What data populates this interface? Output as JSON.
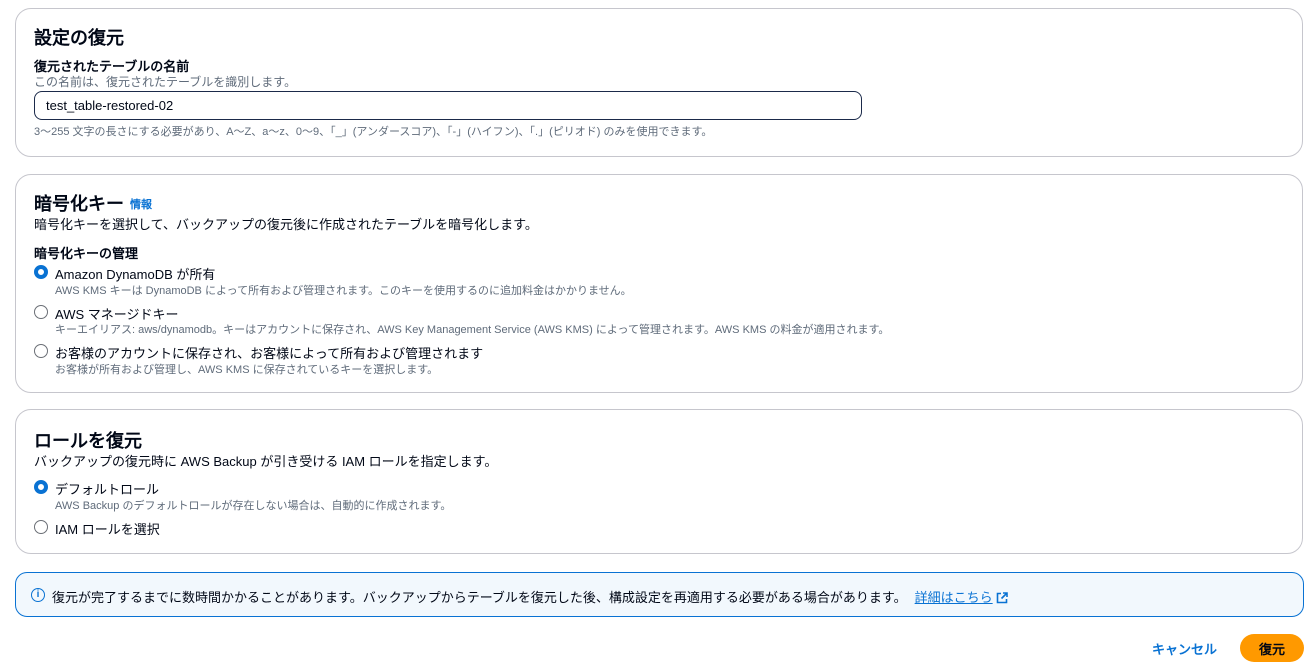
{
  "settings": {
    "title": "設定の復元",
    "name_label": "復元されたテーブルの名前",
    "name_description": "この名前は、復元されたテーブルを識別します。",
    "name_value": "test_table-restored-02",
    "name_constraint": "3～255 文字の長さにする必要があり、A～Z、a～z、0～9、「_」(アンダースコア)、「-」(ハイフン)、「.」(ピリオド) のみを使用できます。"
  },
  "encryption": {
    "title": "暗号化キー",
    "info_link": "情報",
    "description": "暗号化キーを選択して、バックアップの復元後に作成されたテーブルを暗号化します。",
    "management_label": "暗号化キーの管理",
    "options": [
      {
        "label": "Amazon DynamoDB が所有",
        "description": "AWS KMS キーは DynamoDB によって所有および管理されます。このキーを使用するのに追加料金はかかりません。",
        "checked": true
      },
      {
        "label": "AWS マネージドキー",
        "description": "キーエイリアス: aws/dynamodb。キーはアカウントに保存され、AWS Key Management Service (AWS KMS) によって管理されます。AWS KMS の料金が適用されます。",
        "checked": false
      },
      {
        "label": "お客様のアカウントに保存され、お客様によって所有および管理されます",
        "description": "お客様が所有および管理し、AWS KMS に保存されているキーを選択します。",
        "checked": false
      }
    ]
  },
  "role": {
    "title": "ロールを復元",
    "description": "バックアップの復元時に AWS Backup が引き受ける IAM ロールを指定します。",
    "options": [
      {
        "label": "デフォルトロール",
        "description": "AWS Backup のデフォルトロールが存在しない場合は、自動的に作成されます。",
        "checked": true
      },
      {
        "label": "IAM ロールを選択",
        "description": "",
        "checked": false
      }
    ]
  },
  "alert": {
    "text": "復元が完了するまでに数時間かかることがあります。バックアップからテーブルを復元した後、構成設定を再適用する必要がある場合があります。",
    "link": "詳細はこちら"
  },
  "actions": {
    "cancel": "キャンセル",
    "restore": "復元"
  },
  "colors": {
    "accent": "#0972d3",
    "primary_button": "#ff9900"
  }
}
